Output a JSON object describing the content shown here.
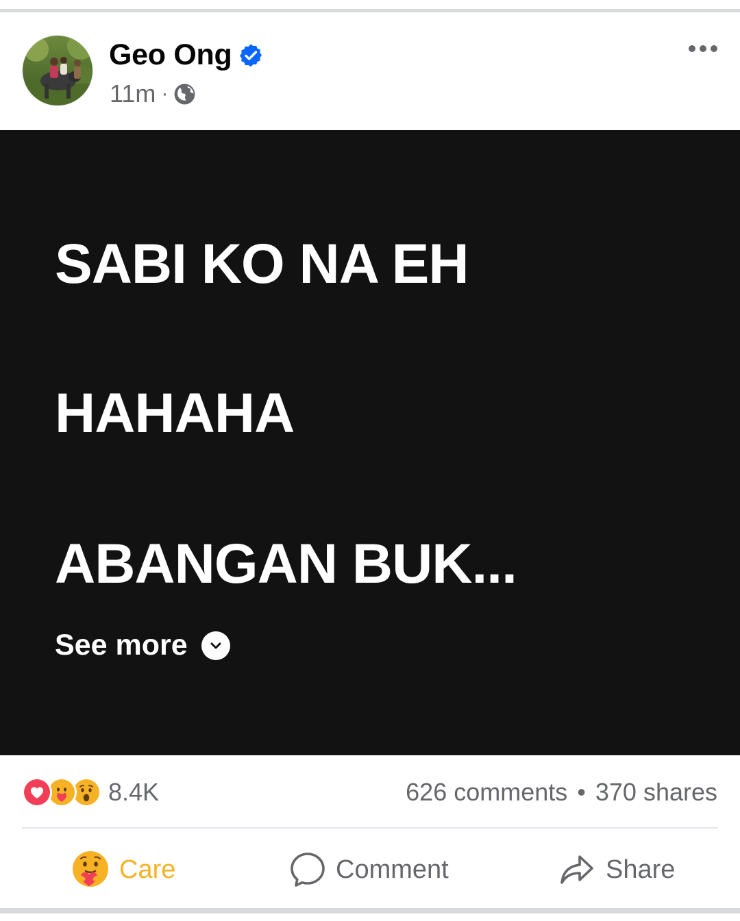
{
  "post": {
    "author": "Geo Ong",
    "time": "11m",
    "separator": "·",
    "body_lines": [
      "SABI KO NA EH",
      "HAHAHA",
      "ABANGAN BUK..."
    ],
    "see_more_label": "See more",
    "background_color": "#121212"
  },
  "reactions": {
    "icons": [
      "heart-reaction",
      "care-reaction",
      "wow-reaction"
    ],
    "count": "8.4K"
  },
  "stats": {
    "comments": "626 comments",
    "dot": "•",
    "shares": "370 shares"
  },
  "actions": {
    "care_label": "Care",
    "comment_label": "Comment",
    "share_label": "Share"
  },
  "colors": {
    "care_active": "#f7b125",
    "muted": "#65676b",
    "verified_blue": "#0866ff",
    "love_red": "#f33e58"
  }
}
